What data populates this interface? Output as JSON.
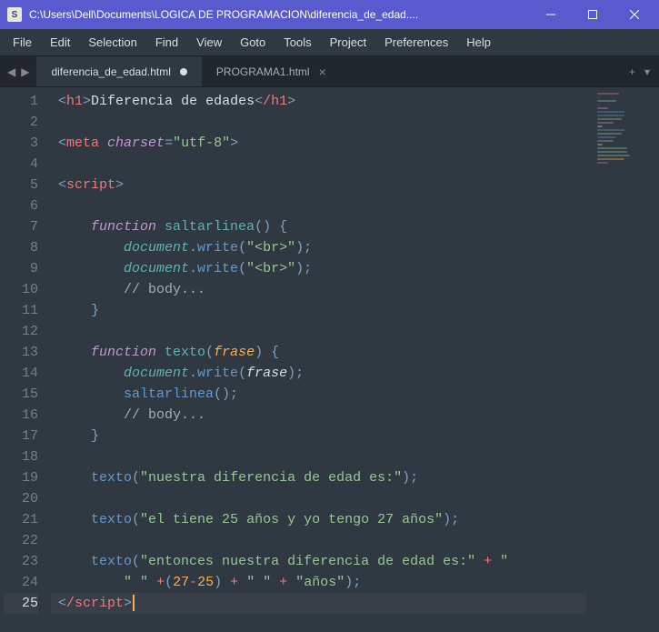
{
  "window": {
    "title": "C:\\Users\\Dell\\Documents\\LOGICA DE PROGRAMACION\\diferencia_de_edad...."
  },
  "menu": {
    "file": "File",
    "edit": "Edit",
    "selection": "Selection",
    "find": "Find",
    "view": "View",
    "goto": "Goto",
    "tools": "Tools",
    "project": "Project",
    "preferences": "Preferences",
    "help": "Help"
  },
  "tabs": [
    {
      "label": "diferencia_de_edad.html",
      "dirty": true,
      "active": true
    },
    {
      "label": "PROGRAMA1.html",
      "dirty": false,
      "active": false
    }
  ],
  "code": {
    "h1_open": "h1",
    "h1_text": "Diferencia de edades",
    "h1_close": "/h1",
    "meta": "meta",
    "meta_attr": "charset",
    "meta_val": "\"utf-8\"",
    "script_open": "script",
    "script_close": "/script",
    "kw_function": "function",
    "fn_saltarlinea": "saltarlinea",
    "fn_texto": "texto",
    "param_frase": "frase",
    "document": "document",
    "write": "write",
    "br_str": "\"<br>\"",
    "comment_body": "// body...",
    "call_texto": "texto",
    "call_saltarlinea": "saltarlinea",
    "str1": "\"nuestra diferencia de edad es:\"",
    "str2": "\"el tiene 25 años y yo tengo 27 años\"",
    "str3a": "\"entonces nuestra diferencia de edad es:\"",
    "str3b": "\" \"",
    "str3c": "\" \"",
    "str3d": "\"años\"",
    "n27": "27",
    "n25": "25"
  },
  "lines": [
    1,
    2,
    3,
    4,
    5,
    6,
    7,
    8,
    9,
    10,
    11,
    12,
    13,
    14,
    15,
    16,
    17,
    18,
    19,
    20,
    21,
    22,
    23,
    24,
    25
  ],
  "activeLine": 25
}
